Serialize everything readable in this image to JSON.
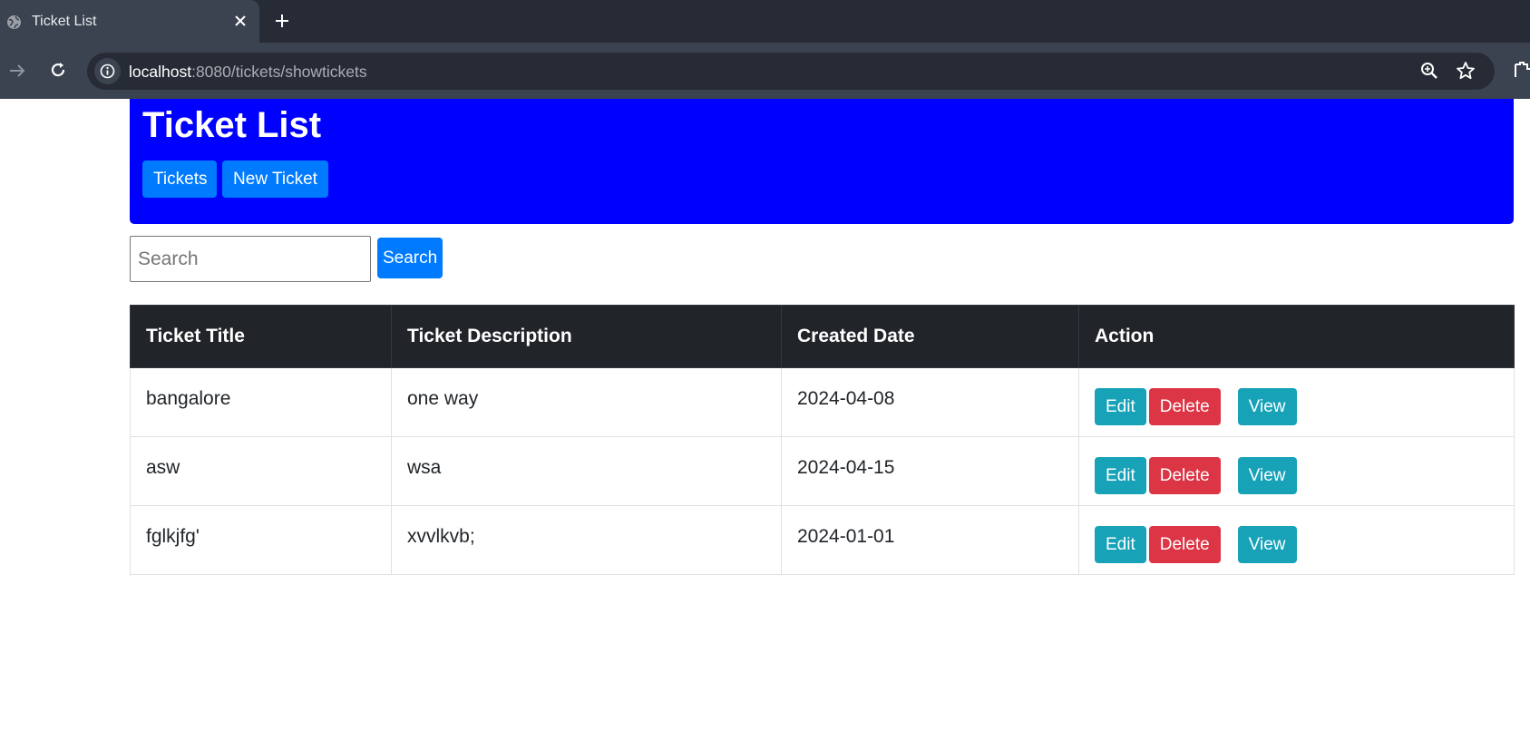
{
  "browser": {
    "tab_title": "Ticket List",
    "url_host": "localhost",
    "url_rest": ":8080/tickets/showtickets"
  },
  "header": {
    "title": "Ticket List",
    "tickets_label": "Tickets",
    "new_ticket_label": "New Ticket",
    "background_color": "#0000ff"
  },
  "search": {
    "placeholder": "Search",
    "button_label": "Search"
  },
  "table": {
    "columns": [
      "Ticket Title",
      "Ticket Description",
      "Created Date",
      "Action"
    ],
    "rows": [
      {
        "title": "bangalore",
        "description": "one way",
        "created": "2024-04-08"
      },
      {
        "title": "asw",
        "description": "wsa",
        "created": "2024-04-15"
      },
      {
        "title": "fglkjfg'",
        "description": "xvvlkvb;",
        "created": "2024-01-01"
      }
    ],
    "actions": {
      "edit": "Edit",
      "delete": "Delete",
      "view": "View"
    }
  },
  "colors": {
    "primary": "#007bff",
    "info": "#17a2b8",
    "danger": "#dc3545",
    "table_header": "#212529"
  }
}
